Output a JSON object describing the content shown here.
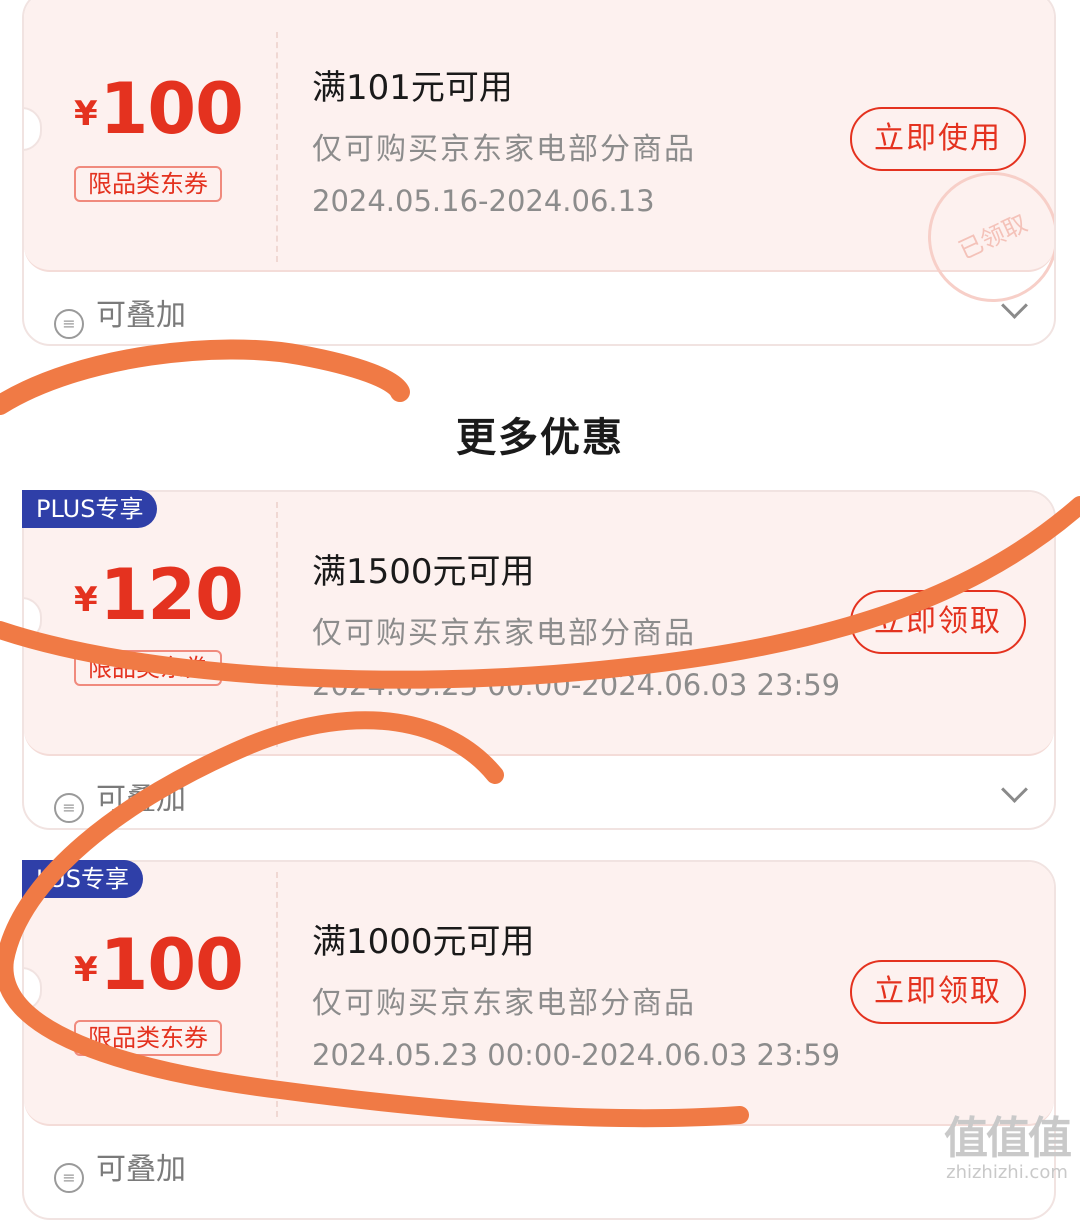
{
  "coupons_top": {
    "currency": "¥",
    "amount": "100",
    "badge": "限品类东券",
    "condition": "满101元可用",
    "scope": "仅可购买京东家电部分商品",
    "validity": "2024.05.16-2024.06.13",
    "action": "立即使用",
    "stamp": "已领取",
    "stackable": "可叠加"
  },
  "section_title": "更多优惠",
  "coupons_more": [
    {
      "tag": "PLUS专享",
      "currency": "¥",
      "amount": "120",
      "badge": "限品类东券",
      "condition": "满1500元可用",
      "scope": "仅可购买京东家电部分商品",
      "validity": "2024.05.23 00:00-2024.06.03 23:59",
      "action": "立即领取",
      "stackable": "可叠加"
    },
    {
      "tag": "LUS专享",
      "currency": "¥",
      "amount": "100",
      "badge": "限品类东券",
      "condition": "满1000元可用",
      "scope": "仅可购买京东家电部分商品",
      "validity": "2024.05.23 00:00-2024.06.03 23:59",
      "action": "立即领取",
      "stackable": "可叠加"
    }
  ],
  "watermark": {
    "glyphs": "值值值",
    "site": "zhizhizhi.com"
  },
  "colors": {
    "accent": "#e4321f",
    "plus_tag": "#2f3fa8",
    "scribble": "#f07a45"
  }
}
